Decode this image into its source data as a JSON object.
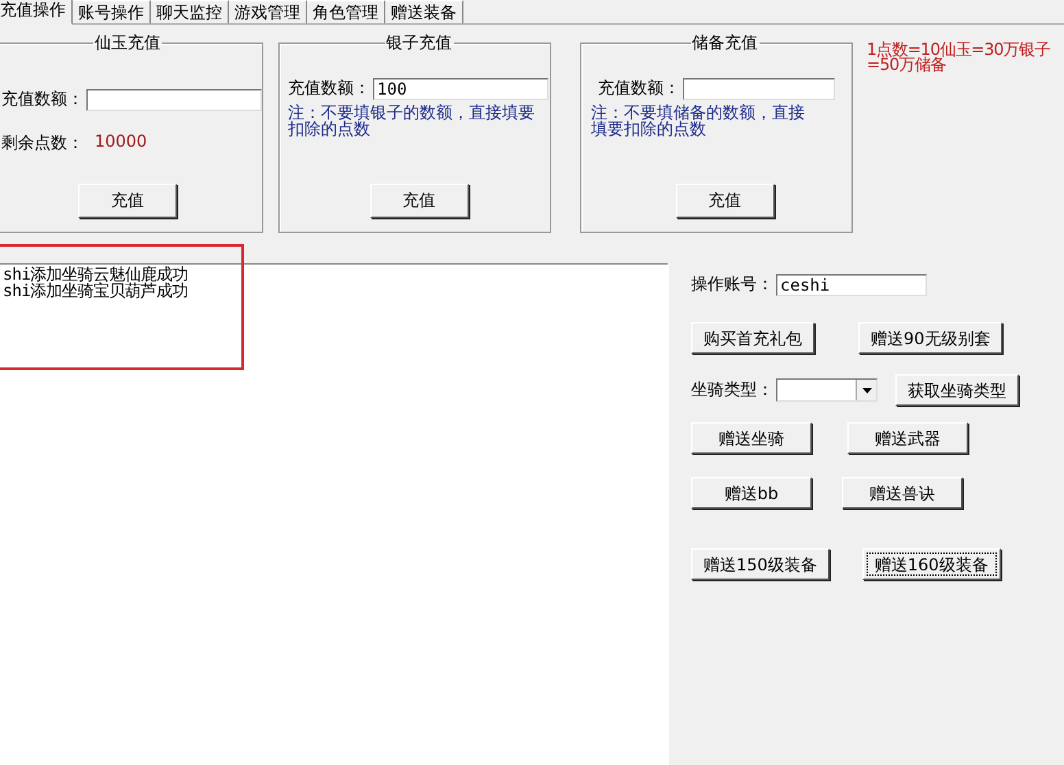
{
  "tabs": [
    {
      "label": "充值操作",
      "selected": true
    },
    {
      "label": "账号操作",
      "selected": false
    },
    {
      "label": "聊天监控",
      "selected": false
    },
    {
      "label": "游戏管理",
      "selected": false
    },
    {
      "label": "角色管理",
      "selected": false
    },
    {
      "label": "赠送装备",
      "selected": false
    }
  ],
  "recharge_groups": [
    {
      "title": "仙玉充值",
      "amount_label": "充值数额：",
      "remaining_label": "剩余点数：",
      "remaining_value": "10000",
      "button": "充值"
    },
    {
      "title": "银子充值",
      "amount_label": "充值数额：",
      "amount_value": "100",
      "note": "注：不要填银子的数额，直接填要扣除的点数",
      "button": "充值"
    },
    {
      "title": "储备充值",
      "amount_label": "充值数额：",
      "note": "注：不要填储备的数额，直接填要扣除的点数",
      "button": "充值"
    }
  ],
  "rate_note": "1点数=10仙玉=30万银子=50万储备",
  "log": {
    "lines": [
      "shi添加坐骑云魅仙鹿成功",
      "shi添加坐骑宝贝葫芦成功"
    ],
    "highlighted": true
  },
  "actions": {
    "account_label": "操作账号：",
    "account_value": "ceshi",
    "rows": [
      {
        "kind": "buttons",
        "buttons": [
          {
            "label": "购买首充礼包",
            "focused": false
          },
          {
            "label": "赠送90无级别套",
            "focused": false
          }
        ]
      },
      {
        "kind": "combo",
        "label": "坐骑类型：",
        "buttons": [
          {
            "label": "获取坐骑类型",
            "focused": false
          }
        ]
      },
      {
        "kind": "buttons",
        "buttons": [
          {
            "label": "赠送坐骑",
            "focused": false
          },
          {
            "label": "赠送武器",
            "focused": false
          }
        ]
      },
      {
        "kind": "buttons",
        "buttons": [
          {
            "label": "赠送bb",
            "focused": false
          },
          {
            "label": "赠送兽诀",
            "focused": false
          }
        ]
      },
      {
        "kind": "buttons",
        "buttons": [
          {
            "label": "赠送150级装备",
            "focused": false
          },
          {
            "label": "赠送160级装备",
            "focused": true
          }
        ]
      }
    ]
  }
}
